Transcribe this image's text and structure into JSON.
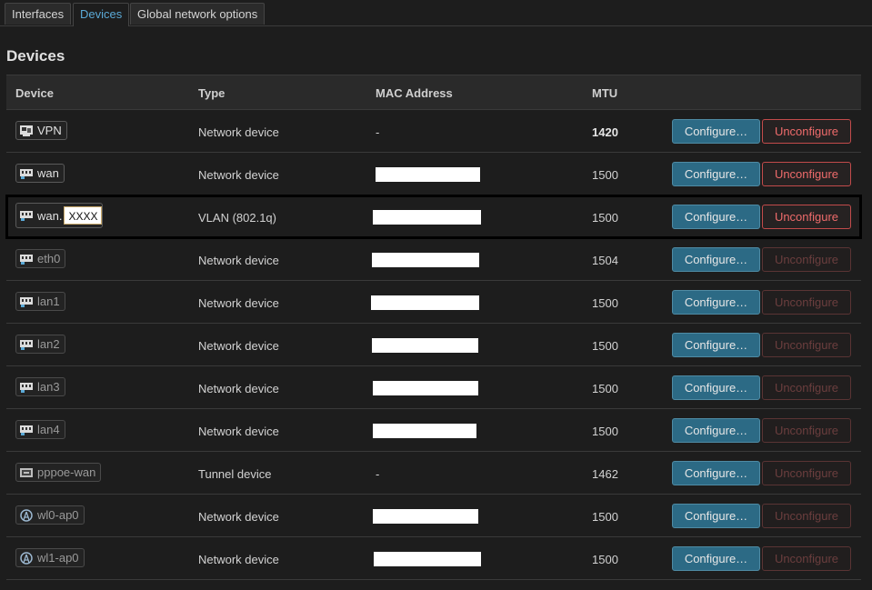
{
  "tabs": [
    {
      "label": "Interfaces",
      "active": false
    },
    {
      "label": "Devices",
      "active": true
    },
    {
      "label": "Global network options",
      "active": false
    }
  ],
  "section_title": "Devices",
  "columns": {
    "device": "Device",
    "type": "Type",
    "mac": "MAC Address",
    "mtu": "MTU"
  },
  "buttons": {
    "configure": "Configure…",
    "unconfigure": "Unconfigure"
  },
  "rows": [
    {
      "device": "VPN",
      "icon": "vpn-icon",
      "type": "Network device",
      "mac": "-",
      "mtu": "1420",
      "unconfigure_enabled": true
    },
    {
      "device": "wan",
      "icon": "ethernet-port-icon",
      "type": "Network device",
      "mac": "",
      "mtu": "1500",
      "unconfigure_enabled": true
    },
    {
      "device": "wan.",
      "vlan_suffix": "XXXX",
      "icon": "ethernet-port-icon",
      "type": "VLAN (802.1q)",
      "mac": "",
      "mtu": "1500",
      "unconfigure_enabled": true
    },
    {
      "device": "eth0",
      "icon": "ethernet-port-icon",
      "type": "Network device",
      "mac": "",
      "mtu": "1504",
      "unconfigure_enabled": false
    },
    {
      "device": "lan1",
      "icon": "ethernet-port-icon",
      "type": "Network device",
      "mac": "",
      "mtu": "1500",
      "unconfigure_enabled": false
    },
    {
      "device": "lan2",
      "icon": "ethernet-port-icon",
      "type": "Network device",
      "mac": "",
      "mtu": "1500",
      "unconfigure_enabled": false
    },
    {
      "device": "lan3",
      "icon": "ethernet-port-icon",
      "type": "Network device",
      "mac": "",
      "mtu": "1500",
      "unconfigure_enabled": false
    },
    {
      "device": "lan4",
      "icon": "ethernet-port-icon",
      "type": "Network device",
      "mac": "",
      "mtu": "1500",
      "unconfigure_enabled": false
    },
    {
      "device": "pppoe-wan",
      "icon": "tunnel-icon",
      "type": "Tunnel device",
      "mac": "-",
      "mtu": "1462",
      "unconfigure_enabled": false
    },
    {
      "device": "wl0-ap0",
      "icon": "wifi-icon",
      "type": "Network device",
      "mac": "",
      "mtu": "1500",
      "unconfigure_enabled": false
    },
    {
      "device": "wl1-ap0",
      "icon": "wifi-icon",
      "type": "Network device",
      "mac": "",
      "mtu": "1500",
      "unconfigure_enabled": false
    }
  ],
  "colors": {
    "accent": "#5ba9d6",
    "configure_bg": "#2c6a85",
    "unconfigure_red": "#ee6b6b"
  }
}
